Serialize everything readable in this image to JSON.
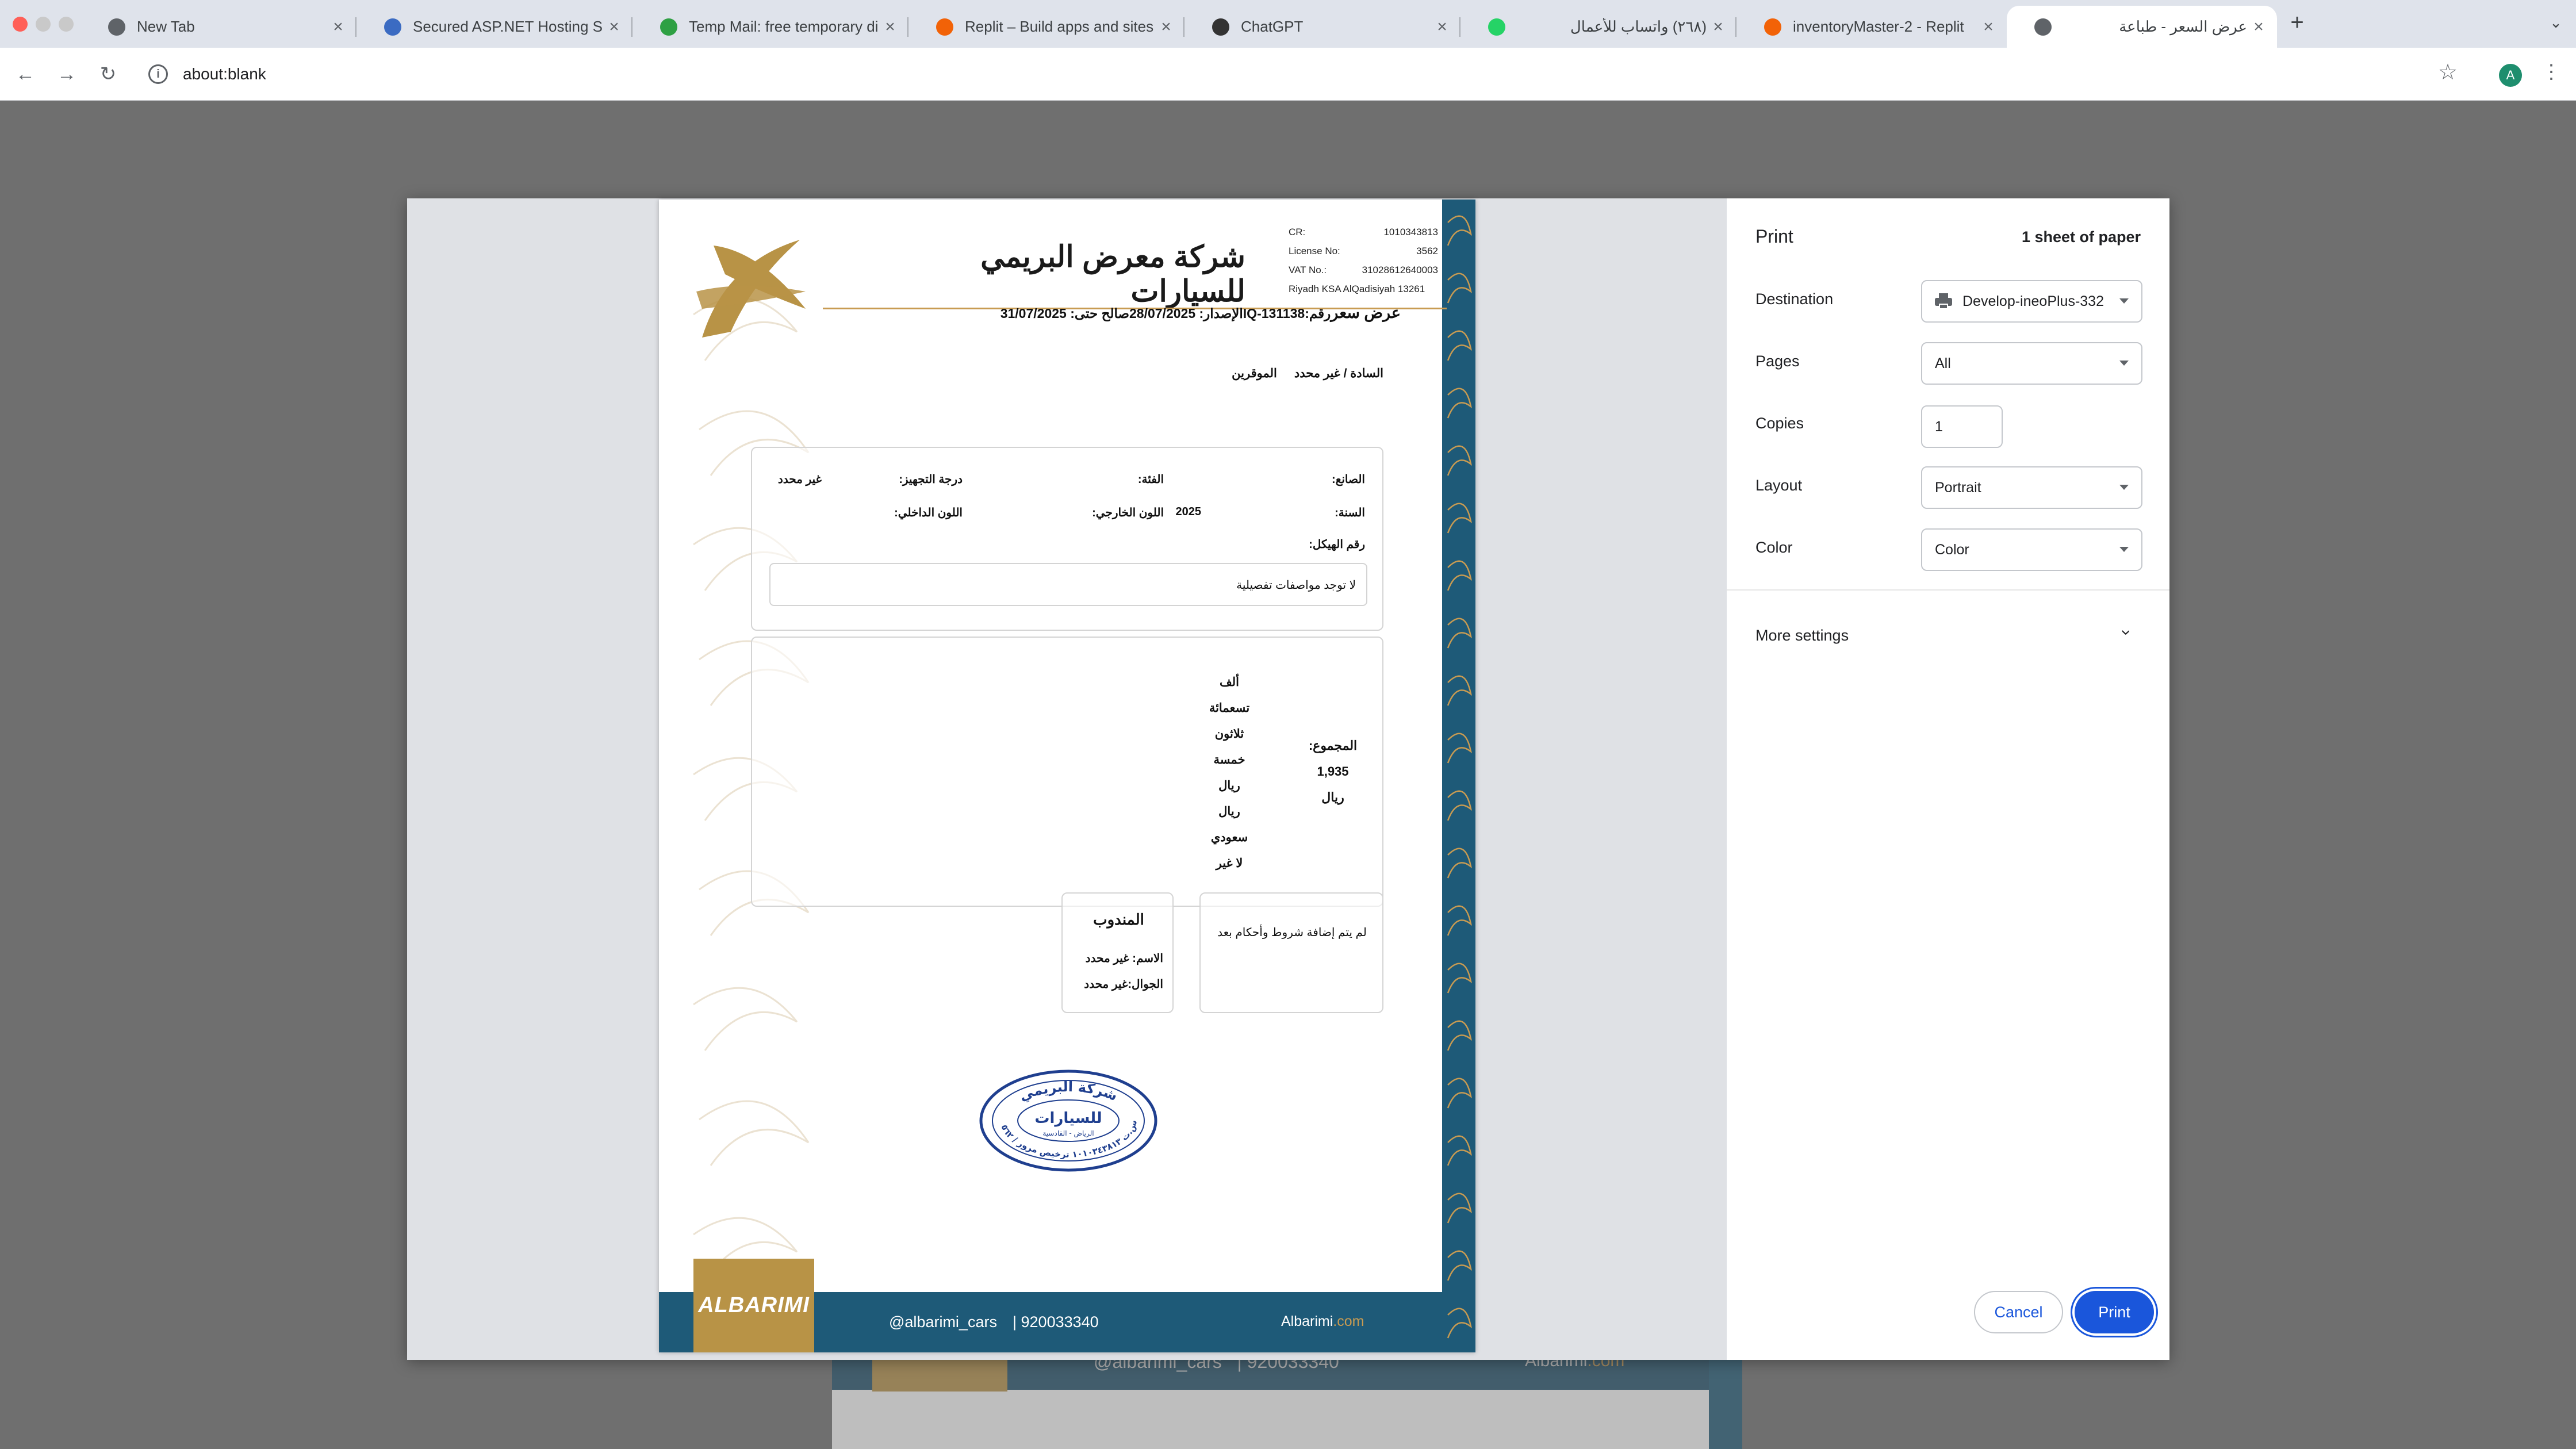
{
  "tabs": [
    {
      "title": "New Tab",
      "icon": "chrome-icon",
      "color": "#5f6368"
    },
    {
      "title": "Secured ASP.NET Hosting Si",
      "icon": "globe-icon",
      "color": "#3b6bc2"
    },
    {
      "title": "Temp Mail: free temporary di",
      "icon": "shield-icon",
      "color": "#2ea043"
    },
    {
      "title": "Replit – Build apps and sites",
      "icon": "replit-icon",
      "color": "#f26207"
    },
    {
      "title": "ChatGPT",
      "icon": "chatgpt-icon",
      "color": "#333333"
    },
    {
      "title": "(٢٦٨) واتساب للأعمال",
      "icon": "whatsapp-icon",
      "color": "#25d366"
    },
    {
      "title": "inventoryMaster-2 - Replit",
      "icon": "replit-icon",
      "color": "#f26207"
    },
    {
      "title": "عرض السعر - طباعة",
      "icon": "globe-icon",
      "color": "#5f6368"
    }
  ],
  "toolbar": {
    "url": "about:blank",
    "profile_initial": "A"
  },
  "document": {
    "company_name": "شركة معرض البريمي للسيارات",
    "cr_label": "CR:",
    "cr_value": "1010343813",
    "license_label": "License No:",
    "license_value": "3562",
    "vat_label": "VAT No.:",
    "vat_value": "31028612640003",
    "address": "Riyadh KSA AlQadisiyah 13261",
    "doc_title": "عرض سعر",
    "doc_number_label": "رقم:",
    "doc_number": "IQ-131138",
    "issue_label": "الإصدار:",
    "issue_date": "28/07/2025",
    "valid_label": "صالح حتى:",
    "valid_date": "31/07/2025",
    "salutation": "السادة / غير محدد",
    "salutation_suffix": "الموقرين",
    "specs": {
      "maker_label": "الصانع:",
      "category_label": "الفئة:",
      "trim_label": "درجة التجهيز:",
      "trim_value": "غير محدد",
      "year_label": "السنة:",
      "year_value": "2025",
      "ext_color_label": "اللون الخارجي:",
      "int_color_label": "اللون الداخلي:",
      "chassis_label": "رقم الهيكل:",
      "detail": "لا توجد مواصفات تفصيلية"
    },
    "totals": {
      "label": "المجموع:",
      "value": "1,935",
      "currency": "ريال",
      "words": [
        "ألف",
        "تسعمائة",
        "ثلاثون",
        "خمسة",
        "ريال",
        "ريال",
        "سعودي",
        "لا غير"
      ]
    },
    "terms": "لم يتم إضافة شروط وأحكام بعد",
    "rep": {
      "title": "المندوب",
      "name_line": "الاسم:  غير محدد",
      "phone_line": "الجوال:غير محدد"
    },
    "stamp": {
      "line1": "شركة البريمي",
      "line2": "للسيارات",
      "line3": "الرياض - القادسية",
      "line4": "س.ت ١٠١٠٣٤٣٨١٣ ترخيص مرور / ٣٥٦٢"
    },
    "footer": {
      "logo_text": "ALBARIMI",
      "social": "@albarimi_cars",
      "phone": "| 920033340",
      "web_name": "Albarimi",
      "web_domain": ".com"
    }
  },
  "print_panel": {
    "title": "Print",
    "sheets": "1 sheet of paper",
    "destination_label": "Destination",
    "destination_value": "Develop-ineoPlus-332",
    "pages_label": "Pages",
    "pages_value": "All",
    "copies_label": "Copies",
    "copies_value": "1",
    "layout_label": "Layout",
    "layout_value": "Portrait",
    "color_label": "Color",
    "color_value": "Color",
    "more_settings": "More settings",
    "cancel_label": "Cancel",
    "print_label": "Print"
  },
  "colors": {
    "accent": "#1a56db",
    "gold": "#c89b52",
    "navy": "#1e5a78"
  }
}
